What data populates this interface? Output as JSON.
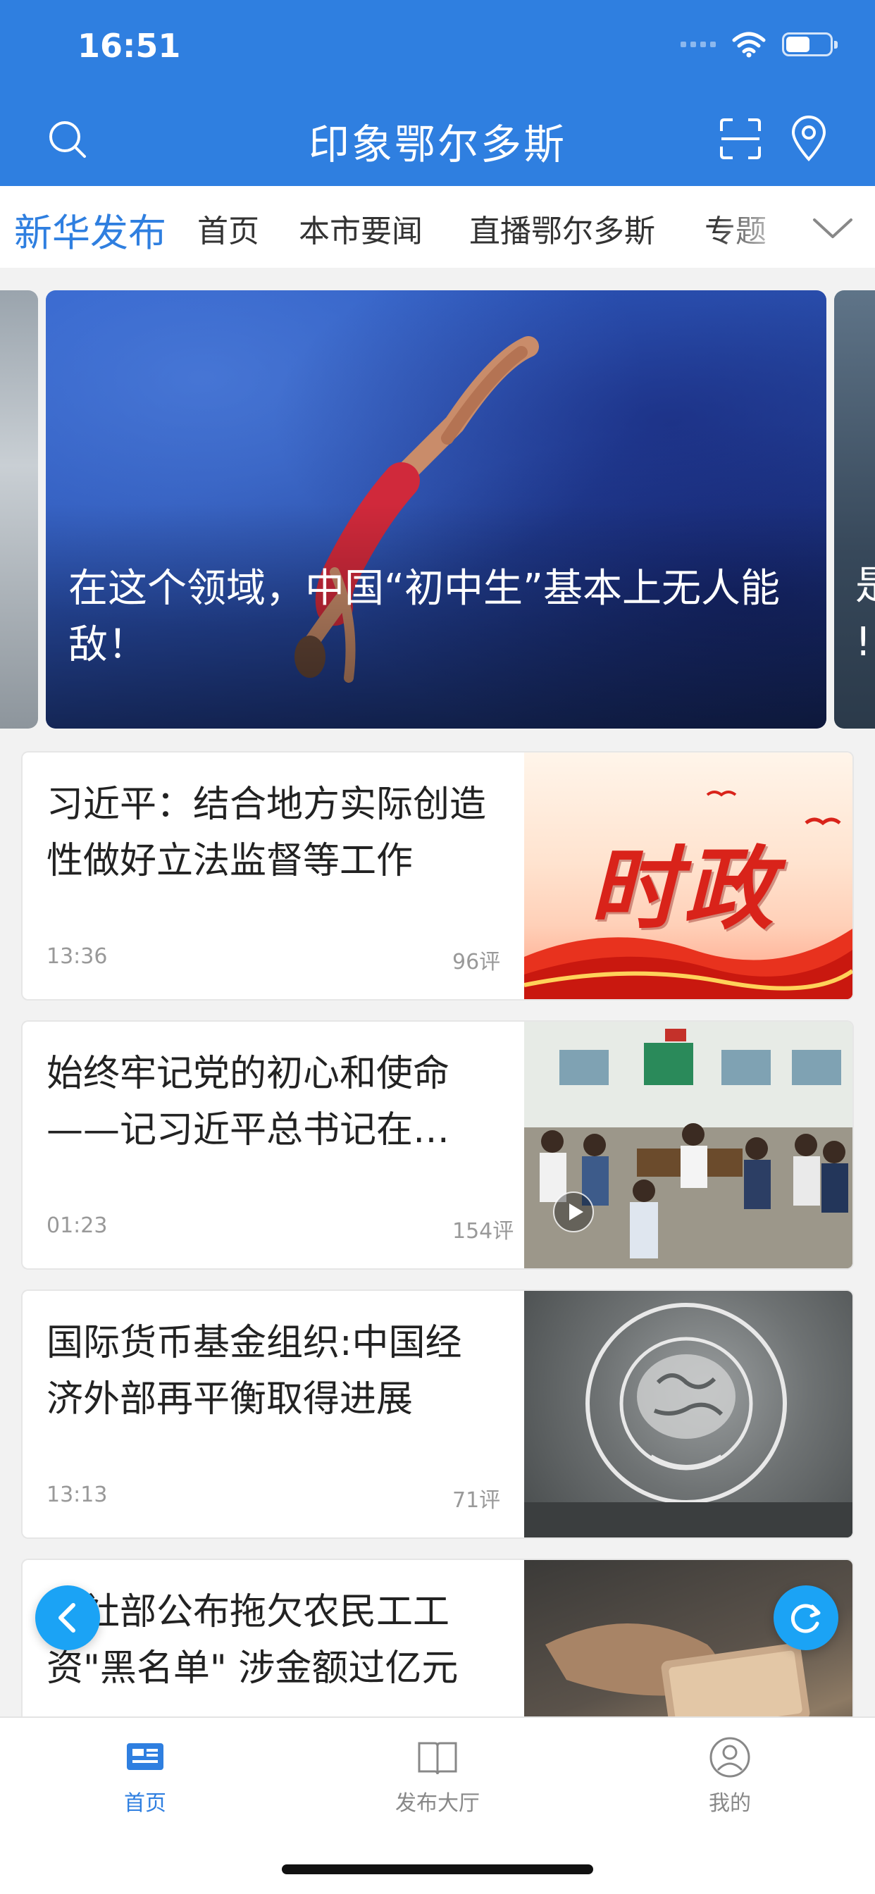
{
  "status": {
    "time": "16:51"
  },
  "header": {
    "title": "印象鄂尔多斯"
  },
  "tabs": [
    {
      "label": "新华发布",
      "active": true
    },
    {
      "label": "首页"
    },
    {
      "label": "本市要闻"
    },
    {
      "label": "直播鄂尔多斯"
    },
    {
      "label": "专题"
    }
  ],
  "carousel": {
    "main_caption": "在这个领域，中国“初中生”基本上无人能敌！",
    "right_caption": "是\n!"
  },
  "news": [
    {
      "title": "习近平：结合地方实际创造性做好立法监督等工作",
      "time": "13:36",
      "comments": "96评",
      "thumb_text": "时政"
    },
    {
      "title": "始终牢记党的初心和使命——记习近平总书记在…",
      "time": "01:23",
      "comments": "154评",
      "video": true
    },
    {
      "title": "国际货币基金组织:中国经济外部再平衡取得进展",
      "time": "13:13",
      "comments": "71评"
    },
    {
      "title": "人社部公布拖欠农民工工资\"黑名单\" 涉金额过亿元",
      "time": "",
      "comments": ""
    }
  ],
  "tabbar": [
    {
      "label": "首页",
      "active": true,
      "icon": "news-icon"
    },
    {
      "label": "发布大厅",
      "icon": "book-icon"
    },
    {
      "label": "我的",
      "icon": "user-icon"
    }
  ],
  "colors": {
    "brand": "#2f7fe0",
    "fab": "#1ba3f5"
  }
}
